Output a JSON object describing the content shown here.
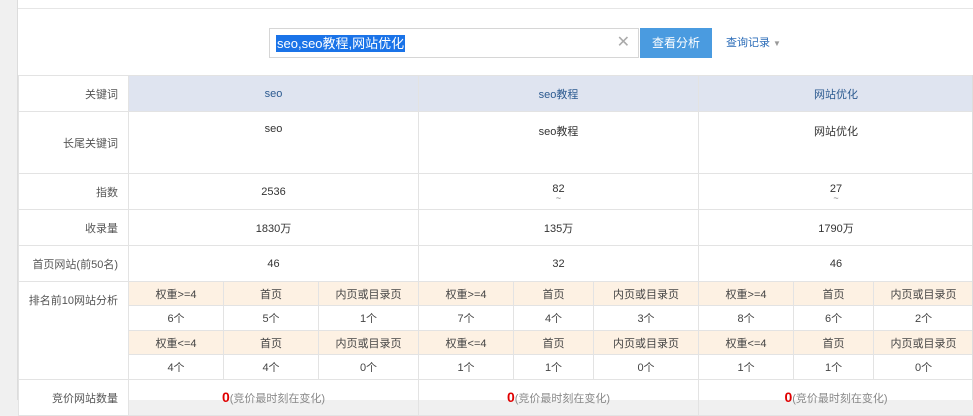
{
  "search": {
    "query": "seo,seo教程,网站优化",
    "clear_icon": "close-icon",
    "submit_label": "查看分析",
    "history_label": "查询记录",
    "history_icon": "caret-down-icon"
  },
  "table": {
    "row_labels": {
      "keyword": "关键词",
      "longtail": "长尾关键词",
      "index": "指数",
      "indexed": "收录量",
      "homepage": "首页网站(前50名)",
      "rank_top10": "排名前10网站分析",
      "bid_count": "竞价网站数量"
    },
    "columns": [
      {
        "keyword": "seo",
        "longtail": "seo",
        "index": "2536",
        "index_mark": "",
        "indexed": "1830万",
        "homepage": "46",
        "rank_head_1": [
          "权重>=4",
          "首页",
          "内页或目录页"
        ],
        "rank_val_1": [
          "6个",
          "5个",
          "1个"
        ],
        "rank_head_2": [
          "权重<=4",
          "首页",
          "内页或目录页"
        ],
        "rank_val_2": [
          "4个",
          "4个",
          "0个"
        ],
        "bid_num": "0",
        "bid_note": "(竞价最时刻在变化)"
      },
      {
        "keyword": "seo教程",
        "longtail": "seo教程",
        "index": "82",
        "index_mark": "~",
        "indexed": "135万",
        "homepage": "32",
        "rank_head_1": [
          "权重>=4",
          "首页",
          "内页或目录页"
        ],
        "rank_val_1": [
          "7个",
          "4个",
          "3个"
        ],
        "rank_head_2": [
          "权重<=4",
          "首页",
          "内页或目录页"
        ],
        "rank_val_2": [
          "1个",
          "1个",
          "0个"
        ],
        "bid_num": "0",
        "bid_note": "(竞价最时刻在变化)"
      },
      {
        "keyword": "网站优化",
        "longtail": "网站优化",
        "index": "27",
        "index_mark": "~",
        "indexed": "1790万",
        "homepage": "46",
        "rank_head_1": [
          "权重>=4",
          "首页",
          "内页或目录页"
        ],
        "rank_val_1": [
          "8个",
          "6个",
          "2个"
        ],
        "rank_head_2": [
          "权重<=4",
          "首页",
          "内页或目录页"
        ],
        "rank_val_2": [
          "1个",
          "1个",
          "0个"
        ],
        "bid_num": "0",
        "bid_note": "(竞价最时刻在变化)"
      }
    ]
  },
  "colors": {
    "accent": "#4a9be0",
    "header_bg": "#dfe4f0",
    "sub_header_bg": "#fdf1e3",
    "highlight": "#e00000"
  }
}
